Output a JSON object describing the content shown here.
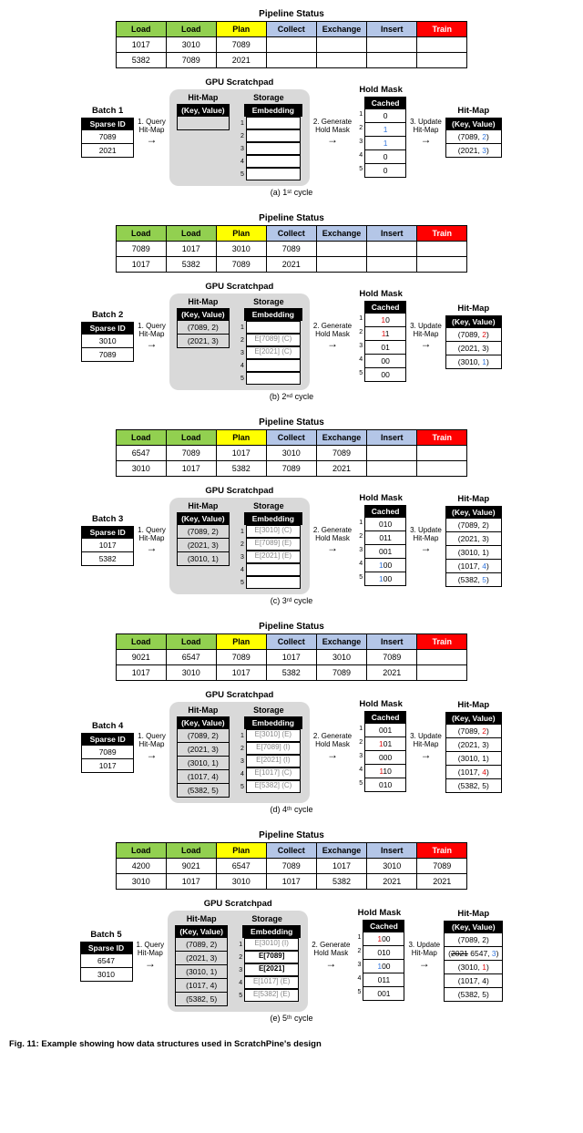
{
  "labels": {
    "pipeline_title": "Pipeline Status",
    "scratchpad_title": "GPU Scratchpad",
    "hitmap_sub": "Hit-Map",
    "storage_sub": "Storage",
    "kv_header": "(Key, Value)",
    "embedding_header": "Embedding",
    "sparse_id_header": "Sparse ID",
    "cached_header": "Cached",
    "holdmask_title": "Hold Mask",
    "hitmap_title": "Hit-Map",
    "step1": "1. Query\nHit-Map",
    "step2": "2. Generate\nHold Mask",
    "step3": "3. Update\nHit-Map",
    "pipeline_headers": [
      "Load",
      "Load",
      "Plan",
      "Collect",
      "Exchange",
      "Insert",
      "Train"
    ]
  },
  "fig_caption": "Fig. 11: Example showing how data structures used in ScratchPine's design",
  "cycles": [
    {
      "id": "a",
      "caption": "(a) 1ˢᵗ cycle",
      "batch_label": "Batch 1",
      "pipeline": [
        [
          "1017",
          "3010",
          "7089",
          "",
          "",
          "",
          ""
        ],
        [
          "5382",
          "7089",
          "2021",
          "",
          "",
          "",
          ""
        ]
      ],
      "batch_ids": [
        "7089",
        "2021"
      ],
      "hitmap_in": [],
      "storage": [
        {
          "txt": "",
          "cls": ""
        },
        {
          "txt": "",
          "cls": ""
        },
        {
          "txt": "",
          "cls": ""
        },
        {
          "txt": "",
          "cls": ""
        },
        {
          "txt": "",
          "cls": ""
        }
      ],
      "holdmask": [
        {
          "txt": "0",
          "cls": ""
        },
        {
          "txt": "1",
          "cls": "blue-txt"
        },
        {
          "txt": "1",
          "cls": "blue-txt"
        },
        {
          "txt": "0",
          "cls": ""
        },
        {
          "txt": "0",
          "cls": ""
        }
      ],
      "hitmap_out": [
        {
          "pre": "(7089, ",
          "val": "2",
          "post": ")",
          "cls": "blue-txt"
        },
        {
          "pre": "(2021, ",
          "val": "3",
          "post": ")",
          "cls": "blue-txt"
        }
      ]
    },
    {
      "id": "b",
      "caption": "(b) 2ⁿᵈ cycle",
      "batch_label": "Batch 2",
      "pipeline": [
        [
          "7089",
          "1017",
          "3010",
          "7089",
          "",
          "",
          ""
        ],
        [
          "1017",
          "5382",
          "7089",
          "2021",
          "",
          "",
          ""
        ]
      ],
      "batch_ids": [
        "3010",
        "7089"
      ],
      "hitmap_in": [
        "(7089, 2)",
        "(2021, 3)"
      ],
      "storage": [
        {
          "txt": "",
          "cls": ""
        },
        {
          "txt": "E[7089] (C)",
          "cls": "grey-txt"
        },
        {
          "txt": "E[2021] (C)",
          "cls": "grey-txt"
        },
        {
          "txt": "",
          "cls": ""
        },
        {
          "txt": "",
          "cls": ""
        }
      ],
      "holdmask": [
        {
          "txt": "10",
          "cls": "",
          "pre": "1",
          "precls": "red-txt",
          "post": "0"
        },
        {
          "txt": "11",
          "cls": "",
          "pre": "1",
          "precls": "red-txt",
          "post": "1"
        },
        {
          "txt": "01",
          "cls": ""
        },
        {
          "txt": "00",
          "cls": ""
        },
        {
          "txt": "00",
          "cls": ""
        }
      ],
      "hitmap_out": [
        {
          "pre": "(7089, ",
          "val": "2",
          "post": ")",
          "cls": "red-txt"
        },
        {
          "pre": "(2021, ",
          "val": "3",
          "post": ")",
          "cls": ""
        },
        {
          "pre": "(3010, ",
          "val": "1",
          "post": ")",
          "cls": "blue-txt"
        }
      ]
    },
    {
      "id": "c",
      "caption": "(c) 3ʳᵈ cycle",
      "batch_label": "Batch 3",
      "pipeline": [
        [
          "6547",
          "7089",
          "1017",
          "3010",
          "7089",
          "",
          ""
        ],
        [
          "3010",
          "1017",
          "5382",
          "7089",
          "2021",
          "",
          ""
        ]
      ],
      "batch_ids": [
        "1017",
        "5382"
      ],
      "hitmap_in": [
        "(7089, 2)",
        "(2021, 3)",
        "(3010, 1)"
      ],
      "storage": [
        {
          "txt": "E[3010] (C)",
          "cls": "grey-txt"
        },
        {
          "txt": "E[7089] (E)",
          "cls": "grey-txt"
        },
        {
          "txt": "E[2021] (E)",
          "cls": "grey-txt"
        },
        {
          "txt": "",
          "cls": ""
        },
        {
          "txt": "",
          "cls": ""
        }
      ],
      "holdmask": [
        {
          "txt": "010",
          "cls": ""
        },
        {
          "txt": "011",
          "cls": ""
        },
        {
          "txt": "001",
          "cls": ""
        },
        {
          "txt": "",
          "pre": "1",
          "precls": "blue-txt",
          "post": "00"
        },
        {
          "txt": "",
          "pre": "1",
          "precls": "blue-txt",
          "post": "00"
        }
      ],
      "hitmap_out": [
        {
          "pre": "(7089, ",
          "val": "2",
          "post": ")",
          "cls": ""
        },
        {
          "pre": "(2021, ",
          "val": "3",
          "post": ")",
          "cls": ""
        },
        {
          "pre": "(3010, ",
          "val": "1",
          "post": ")",
          "cls": ""
        },
        {
          "pre": "(1017, ",
          "val": "4",
          "post": ")",
          "cls": "blue-txt"
        },
        {
          "pre": "(5382, ",
          "val": "5",
          "post": ")",
          "cls": "blue-txt"
        }
      ]
    },
    {
      "id": "d",
      "caption": "(d) 4ᵗʰ cycle",
      "batch_label": "Batch 4",
      "pipeline": [
        [
          "9021",
          "6547",
          "7089",
          "1017",
          "3010",
          "7089",
          ""
        ],
        [
          "1017",
          "3010",
          "1017",
          "5382",
          "7089",
          "2021",
          ""
        ]
      ],
      "batch_ids": [
        "7089",
        "1017"
      ],
      "hitmap_in": [
        "(7089, 2)",
        "(2021, 3)",
        "(3010, 1)",
        "(1017, 4)",
        "(5382, 5)"
      ],
      "storage": [
        {
          "txt": "E[3010] (E)",
          "cls": "grey-txt"
        },
        {
          "txt": "E[7089] (I)",
          "cls": "grey-txt"
        },
        {
          "txt": "E[2021] (I)",
          "cls": "grey-txt"
        },
        {
          "txt": "E[1017] (C)",
          "cls": "grey-txt"
        },
        {
          "txt": "E[5382] (C)",
          "cls": "grey-txt"
        }
      ],
      "holdmask": [
        {
          "txt": "001",
          "cls": ""
        },
        {
          "txt": "",
          "pre": "1",
          "precls": "red-txt",
          "post": "01"
        },
        {
          "txt": "000",
          "cls": ""
        },
        {
          "txt": "",
          "pre": "1",
          "precls": "red-txt",
          "post": "10"
        },
        {
          "txt": "010",
          "cls": ""
        }
      ],
      "hitmap_out": [
        {
          "pre": "(7089, ",
          "val": "2",
          "post": ")",
          "cls": "red-txt"
        },
        {
          "pre": "(2021, ",
          "val": "3",
          "post": ")",
          "cls": ""
        },
        {
          "pre": "(3010, ",
          "val": "1",
          "post": ")",
          "cls": ""
        },
        {
          "pre": "(1017, ",
          "val": "4",
          "post": ")",
          "cls": "red-txt"
        },
        {
          "pre": "(5382, ",
          "val": "5",
          "post": ")",
          "cls": ""
        }
      ]
    },
    {
      "id": "e",
      "caption": "(e) 5ᵗʰ cycle",
      "batch_label": "Batch 5",
      "pipeline": [
        [
          "4200",
          "9021",
          "6547",
          "7089",
          "1017",
          "3010",
          "7089"
        ],
        [
          "3010",
          "1017",
          "3010",
          "1017",
          "5382",
          "2021",
          "2021"
        ]
      ],
      "batch_ids": [
        "6547",
        "3010"
      ],
      "hitmap_in": [
        "(7089, 2)",
        "(2021, 3)",
        "(3010, 1)",
        "(1017, 4)",
        "(5382, 5)"
      ],
      "storage": [
        {
          "txt": "E[3010] (I)",
          "cls": "grey-txt"
        },
        {
          "txt": "E[7089]",
          "cls": "",
          "bold": true
        },
        {
          "txt": "E[2021]",
          "cls": "",
          "bold": true
        },
        {
          "txt": "E[1017] (E)",
          "cls": "grey-txt"
        },
        {
          "txt": "E[5382] (E)",
          "cls": "grey-txt"
        }
      ],
      "holdmask": [
        {
          "txt": "",
          "pre": "1",
          "precls": "red-txt",
          "post": "00"
        },
        {
          "txt": "010",
          "cls": ""
        },
        {
          "txt": "",
          "pre": "1",
          "precls": "blue-txt",
          "post": "00"
        },
        {
          "txt": "011",
          "cls": ""
        },
        {
          "txt": "001",
          "cls": ""
        }
      ],
      "hitmap_out": [
        {
          "pre": "(7089, ",
          "val": "2",
          "post": ")",
          "cls": ""
        },
        {
          "special": "e_strike"
        },
        {
          "pre": "(3010, ",
          "val": "1",
          "post": ")",
          "cls": "red-txt"
        },
        {
          "pre": "(1017, ",
          "val": "4",
          "post": ")",
          "cls": ""
        },
        {
          "pre": "(5382, ",
          "val": "5",
          "post": ")",
          "cls": ""
        }
      ]
    }
  ]
}
